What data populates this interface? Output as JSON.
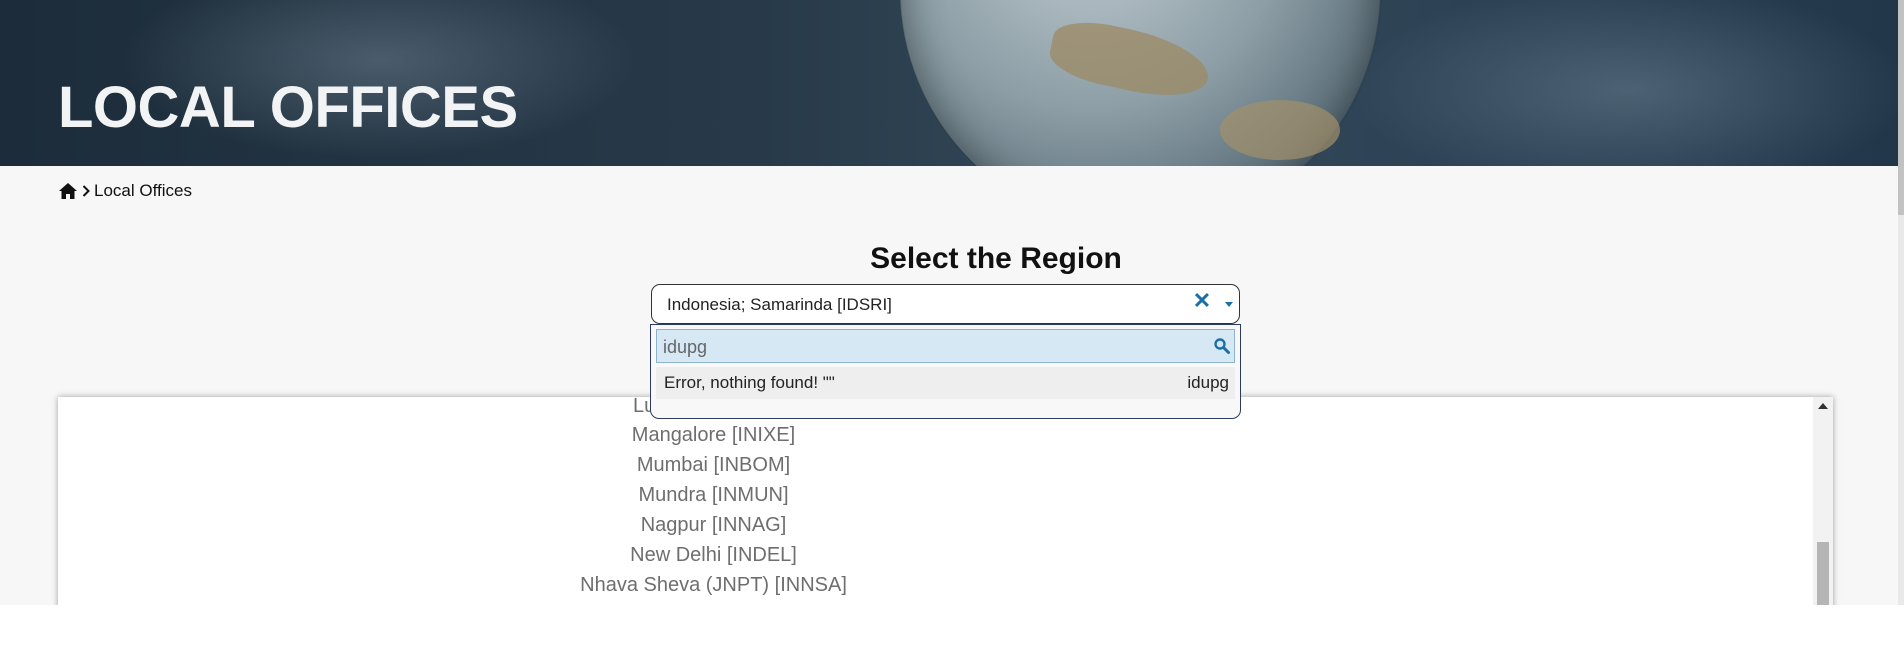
{
  "hero": {
    "title": "LOCAL OFFICES"
  },
  "breadcrumb": {
    "home_icon": "home-icon",
    "separator_icon": "chevron-right-icon",
    "current": "Local Offices"
  },
  "region": {
    "heading": "Select the Region",
    "selected_value": "Indonesia; Samarinda [IDSRI]",
    "clear_symbol": "✕",
    "search_value": "idupg",
    "search_icon": "search-icon",
    "result_message": "Error, nothing found! \"\"",
    "result_query": "idupg"
  },
  "offices": {
    "items": [
      "Lu",
      "Mangalore [INIXE]",
      "Mumbai [INBOM]",
      "Mundra [INMUN]",
      "Nagpur [INNAG]",
      "New Delhi [INDEL]",
      "Nhava Sheva (JNPT) [INNSA]"
    ]
  },
  "colors": {
    "accent": "#1a6fa6",
    "search_bg": "#d6e8f4",
    "dropdown_border": "#2c3b63"
  }
}
